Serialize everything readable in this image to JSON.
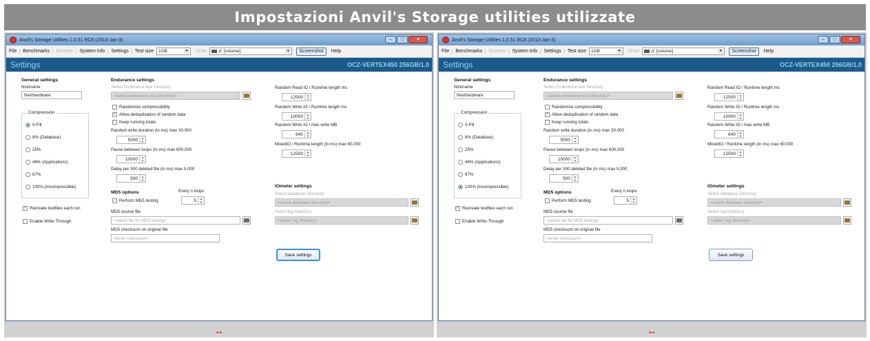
{
  "page": {
    "banner_title": "Impostazioni Anvil's Storage utilities utilizzate"
  },
  "panels": [
    {
      "window": {
        "title": "Anvil's Storage Utilities 1.0.51 RC6 (2013-Jan-3)",
        "menu": {
          "file": "File",
          "benchmarks": "Benchmarks",
          "iometer": "IOmeter",
          "system_info": "System Info",
          "settings": "Settings",
          "test_size_label": "Test size",
          "test_size_value": "1GB",
          "drive_label": "Drive",
          "drive_value": "d: [volume]",
          "screenshot": "Screenshot",
          "help": "Help"
        },
        "header": {
          "title": "Settings",
          "device": "OCZ-VERTEX450 256GB/1.0"
        }
      },
      "general": {
        "title": "General settings",
        "nickname_label": "Nickname",
        "nickname_value": "Nexthardware",
        "compression": {
          "title": "Compression",
          "options": [
            "0-Fill",
            "8% (Database)",
            "25%",
            "46% (Applications)",
            "67%",
            "100% (Incompressible)"
          ],
          "selected_index": 0
        },
        "recreate_label": "Recreate testfiles each run",
        "recreate_checked": true,
        "write_through_label": "Enable Write-Through",
        "write_through_checked": false
      },
      "endurance": {
        "title": "Endurance settings",
        "select_dir_label": "Select Endurance test Directory",
        "dir_placeholder": "<select endurance test directory>",
        "randomize_label": "Randomize compressibility",
        "randomize_checked": false,
        "dedup_label": "Allow deduplication of random data",
        "dedup_checked": true,
        "totals_label": "Keep running totals",
        "totals_checked": false,
        "rw_duration_label": "Random write duration (in ms) max 30,000",
        "rw_duration_value": "5000",
        "pause_label": "Pause between loops (in ms) max 600,000",
        "pause_value": "10000",
        "delay_label": "Delay per 500 deleted file (in ms) max 5,000",
        "delay_value": "500"
      },
      "md5": {
        "title": "MD5 options",
        "every_n_label": "Every n loops",
        "every_n_value": "5",
        "perform_label": "Perform MD5 testing",
        "perform_checked": false,
        "source_label": "MD5 source file",
        "source_placeholder": "<select file for MD5 testing>",
        "checksum_label": "MD5 checksum on original file",
        "checksum_placeholder": "<enter checksum>"
      },
      "runtime": {
        "rr_label": "Random Read IO / Runtime length ms",
        "rr_value": "12500",
        "rw_label": "Random Write IO / Runtime length ms",
        "rw_value": "10000",
        "rwmax_label": "Random Write IO / max write MB",
        "rwmax_value": "640",
        "mixed_label": "MixedIO / Runtime length (in ms) max 60,000",
        "mixed_value": "12500"
      },
      "iometer": {
        "title": "IOmeter settings",
        "db_dir_label": "Select database Directory",
        "db_dir_placeholder": "<select database directory>",
        "log_dir_label": "Select log Directory",
        "log_dir_placeholder": "<select log directory>"
      },
      "save_label": "Save settings",
      "footer_arrow": "↔"
    },
    {
      "window": {
        "title": "Anvil's Storage Utilities 1.0.51 RC6 (2013-Jan-3)",
        "menu": {
          "file": "File",
          "benchmarks": "Benchmarks",
          "iometer": "IOmeter",
          "system_info": "System Info",
          "settings": "Settings",
          "test_size_label": "Test size",
          "test_size_value": "1GB",
          "drive_label": "Drive",
          "drive_value": "d: [volume]",
          "screenshot": "Screenshot",
          "help": "Help"
        },
        "header": {
          "title": "Settings",
          "device": "OCZ-VERTEX450 256GB/1.0"
        }
      },
      "general": {
        "title": "General settings",
        "nickname_label": "Nickname",
        "nickname_value": "Nexthardware",
        "compression": {
          "title": "Compression",
          "options": [
            "0-Fill",
            "8% (Database)",
            "25%",
            "46% (Applications)",
            "67%",
            "100% (Incompressible)"
          ],
          "selected_index": 5
        },
        "recreate_label": "Recreate testfiles each run",
        "recreate_checked": true,
        "write_through_label": "Enable Write-Through",
        "write_through_checked": false
      },
      "endurance": {
        "title": "Endurance settings",
        "select_dir_label": "Select Endurance test Directory",
        "dir_placeholder": "<select endurance test directory>",
        "randomize_label": "Randomize compressibility",
        "randomize_checked": false,
        "dedup_label": "Allow deduplication of random data",
        "dedup_checked": true,
        "totals_label": "Keep running totals",
        "totals_checked": false,
        "rw_duration_label": "Random write duration (in ms) max 30,000",
        "rw_duration_value": "5000",
        "pause_label": "Pause between loops (in ms) max 600,000",
        "pause_value": "10000",
        "delay_label": "Delay per 500 deleted file (in ms) max 5,000",
        "delay_value": "500"
      },
      "md5": {
        "title": "MD5 options",
        "every_n_label": "Every n loops",
        "every_n_value": "5",
        "perform_label": "Perform MD5 testing",
        "perform_checked": false,
        "source_label": "MD5 source file",
        "source_placeholder": "<select file for MD5 testing>",
        "checksum_label": "MD5 checksum on original file",
        "checksum_placeholder": "<enter checksum>"
      },
      "runtime": {
        "rr_label": "Random Read IO / Runtime length ms",
        "rr_value": "12500",
        "rw_label": "Random Write IO / Runtime length ms",
        "rw_value": "10000",
        "rwmax_label": "Random Write IO / max write MB",
        "rwmax_value": "640",
        "mixed_label": "MixedIO / Runtime length (in ms) max 60,000",
        "mixed_value": "12500"
      },
      "iometer": {
        "title": "IOmeter settings",
        "db_dir_label": "Select database Directory",
        "db_dir_placeholder": "<select database directory>",
        "log_dir_label": "Select log Directory",
        "log_dir_placeholder": "<select log directory>"
      },
      "save_label": "Save settings",
      "footer_arrow": "↔"
    }
  ]
}
